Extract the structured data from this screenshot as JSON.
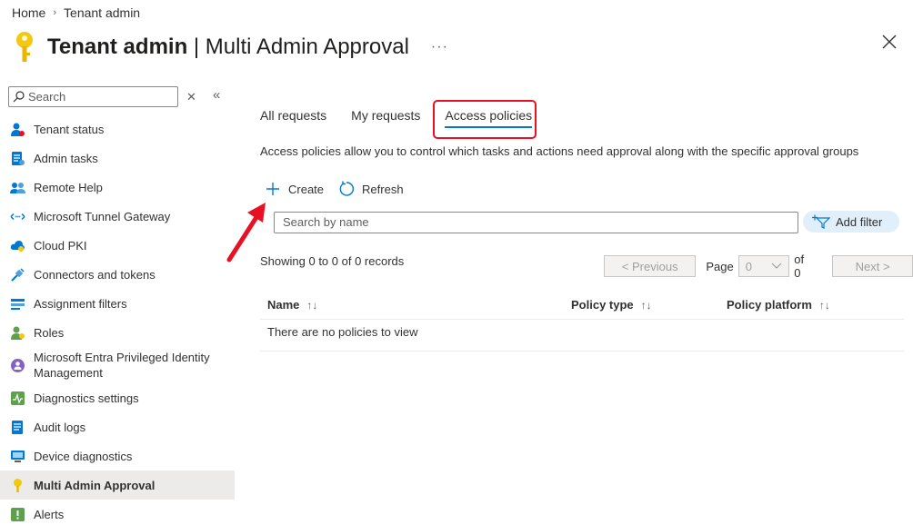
{
  "breadcrumb": {
    "home": "Home",
    "sep": "›",
    "current": "Tenant admin"
  },
  "header": {
    "title_bold": "Tenant admin",
    "title_rest": " | Multi Admin Approval",
    "more": "···"
  },
  "sidebar": {
    "search_placeholder": "Search",
    "clear": "✕",
    "collapse": "«",
    "items": [
      {
        "label": "Tenant status",
        "icon": "person-status-icon"
      },
      {
        "label": "Admin tasks",
        "icon": "tasks-icon"
      },
      {
        "label": "Remote Help",
        "icon": "people-icon"
      },
      {
        "label": "Microsoft Tunnel Gateway",
        "icon": "tunnel-icon"
      },
      {
        "label": "Cloud PKI",
        "icon": "cloud-icon"
      },
      {
        "label": "Connectors and tokens",
        "icon": "connector-icon"
      },
      {
        "label": "Assignment filters",
        "icon": "filter-list-icon"
      },
      {
        "label": "Roles",
        "icon": "roles-icon"
      },
      {
        "label": "Microsoft Entra Privileged Identity Management",
        "icon": "pim-icon"
      },
      {
        "label": "Diagnostics settings",
        "icon": "diagnostics-icon"
      },
      {
        "label": "Audit logs",
        "icon": "audit-icon"
      },
      {
        "label": "Device diagnostics",
        "icon": "device-icon"
      },
      {
        "label": "Multi Admin Approval",
        "icon": "key-icon"
      },
      {
        "label": "Alerts",
        "icon": "alert-icon"
      }
    ]
  },
  "tabs": [
    {
      "label": "All requests"
    },
    {
      "label": "My requests"
    },
    {
      "label": "Access policies"
    }
  ],
  "description": "Access policies allow you to control which tasks and actions need approval along with the specific approval groups",
  "toolbar": {
    "create": "Create",
    "refresh": "Refresh"
  },
  "search": {
    "placeholder": "Search by name"
  },
  "filter": {
    "label": "Add filter"
  },
  "records": "Showing 0 to 0 of 0 records",
  "pager": {
    "previous": "< Previous",
    "page_label": "Page",
    "page_value": "0",
    "of": "of 0",
    "next": "Next >"
  },
  "grid": {
    "columns": [
      {
        "label": "Name",
        "sort": "↑↓"
      },
      {
        "label": "Policy type",
        "sort": "↑↓"
      },
      {
        "label": "Policy platform",
        "sort": "↑↓"
      }
    ],
    "empty": "There are no policies to view"
  },
  "colors": {
    "accent": "#0078d4",
    "highlight": "#e81123",
    "active_bg": "#edebe9"
  }
}
